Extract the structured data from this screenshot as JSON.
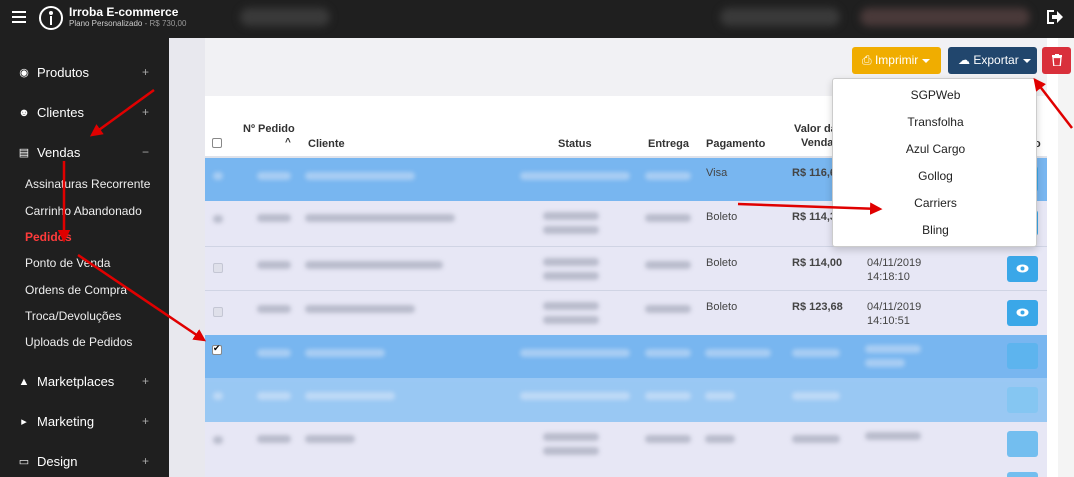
{
  "app": {
    "brand": "Irroba E-commerce",
    "plan": "Plano Personalizado",
    "price": "- R$ 730,00"
  },
  "sidebar": {
    "items": [
      {
        "label": "Produtos",
        "icon": "camera-icon",
        "toggle": "+"
      },
      {
        "label": "Clientes",
        "icon": "users-icon",
        "toggle": "+"
      },
      {
        "label": "Vendas",
        "icon": "cart-icon",
        "toggle": "−"
      },
      {
        "label": "Marketplaces",
        "icon": "sitemap-icon",
        "toggle": "+"
      },
      {
        "label": "Marketing",
        "icon": "bullhorn-icon",
        "toggle": "+"
      },
      {
        "label": "Design",
        "icon": "laptop-icon",
        "toggle": "+"
      }
    ],
    "vendas_sub": [
      {
        "label": "Assinaturas Recorrente"
      },
      {
        "label": "Carrinho Abandonado"
      },
      {
        "label": "Pedidos",
        "active": true
      },
      {
        "label": "Ponto de Venda"
      },
      {
        "label": "Ordens de Compra"
      },
      {
        "label": "Troca/Devoluções"
      },
      {
        "label": "Uploads de Pedidos"
      }
    ]
  },
  "toolbar": {
    "print_label": "Imprimir",
    "export_label": "Exportar"
  },
  "export_menu": {
    "items": [
      "SGPWeb",
      "Transfolha",
      "Azul Cargo",
      "Gollog",
      "Carriers",
      "Bling"
    ]
  },
  "table": {
    "headers": {
      "order_no": "Nº Pedido",
      "client": "Cliente",
      "status": "Status",
      "delivery": "Entrega",
      "payment": "Pagamento",
      "value_line1": "Valor da",
      "value_line2": "Venda",
      "last": "o"
    },
    "rows": [
      {
        "payment": "Visa",
        "value": "R$ 116,6",
        "date": "",
        "time": "",
        "checked": false
      },
      {
        "payment": "Boleto",
        "value": "R$ 114,3",
        "date": "",
        "time": "",
        "checked": false
      },
      {
        "payment": "Boleto",
        "value": "R$ 114,00",
        "date": "04/11/2019",
        "time": "14:18:10",
        "checked": false
      },
      {
        "payment": "Boleto",
        "value": "R$ 123,68",
        "date": "04/11/2019",
        "time": "14:10:51",
        "checked": false
      },
      {
        "payment": "",
        "value": "",
        "date": "",
        "time": "",
        "checked": true
      }
    ]
  },
  "colors": {
    "topbar": "#1f1f1f",
    "print": "#f0ad00",
    "export": "#21466d",
    "delete": "#d9303b",
    "active_nav": "#ff3b3b",
    "row_highlight": "#78b6f0",
    "arrow": "#e00000"
  }
}
